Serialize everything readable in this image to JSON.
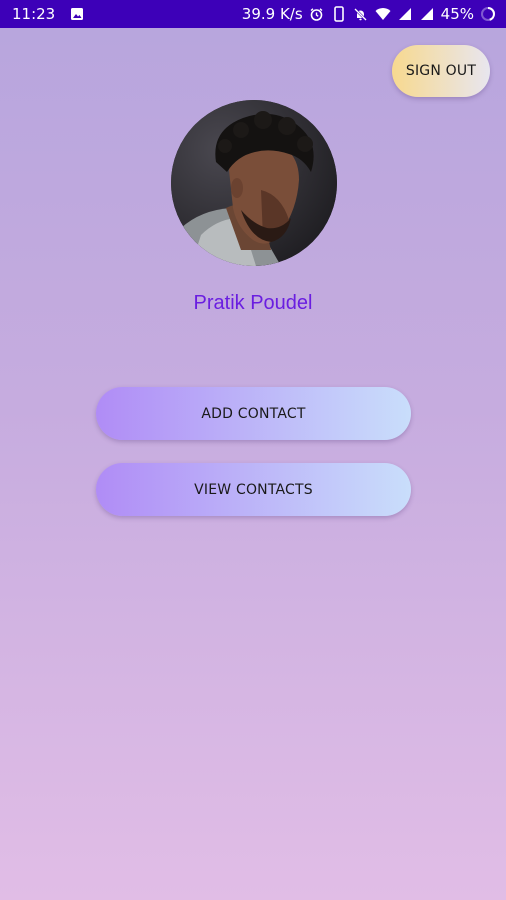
{
  "status_bar": {
    "time": "11:23",
    "network_speed": "39.9 K/s",
    "battery": "45%",
    "icons": [
      "image-icon",
      "alarm-icon",
      "vibrate-icon",
      "mute-icon",
      "wifi-icon",
      "signal-icon",
      "signal-icon",
      "battery-icon"
    ]
  },
  "header": {
    "sign_out_label": "SIGN OUT"
  },
  "profile": {
    "name": "Pratik Poudel"
  },
  "actions": {
    "add_contact_label": "ADD CONTACT",
    "view_contacts_label": "VIEW CONTACTS"
  },
  "colors": {
    "status_bar": "#3d00b8",
    "name_text": "#6a1ee0",
    "background_top": "#b7a5dd",
    "background_bottom": "#e1bde6"
  }
}
